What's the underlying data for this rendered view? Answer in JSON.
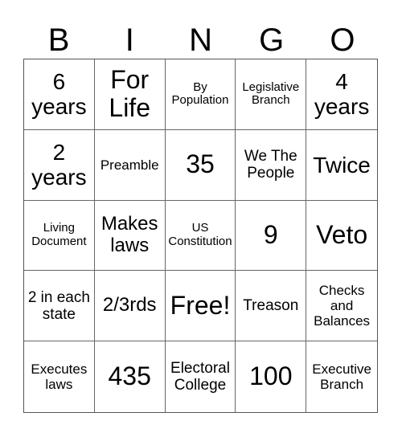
{
  "header": [
    "B",
    "I",
    "N",
    "G",
    "O"
  ],
  "cells": [
    {
      "text": "6 years",
      "size": "s4"
    },
    {
      "text": "For Life",
      "size": "s5"
    },
    {
      "text": "By Population",
      "size": "s1"
    },
    {
      "text": "Legislative Branch",
      "size": "s1"
    },
    {
      "text": "4 years",
      "size": "s4"
    },
    {
      "text": "2 years",
      "size": "s4"
    },
    {
      "text": "Preamble",
      "size": "s3"
    },
    {
      "text": "35",
      "size": "s5"
    },
    {
      "text": "We The People",
      "size": "s2"
    },
    {
      "text": "Twice",
      "size": "s4"
    },
    {
      "text": "Living Document",
      "size": "s1"
    },
    {
      "text": "Makes laws",
      "size": "s6"
    },
    {
      "text": "US Constitution",
      "size": "s1"
    },
    {
      "text": "9",
      "size": "s5"
    },
    {
      "text": "Veto",
      "size": "s5"
    },
    {
      "text": "2 in each state",
      "size": "s2"
    },
    {
      "text": "2/3rds",
      "size": "s6"
    },
    {
      "text": "Free!",
      "size": "s5"
    },
    {
      "text": "Treason",
      "size": "s2"
    },
    {
      "text": "Checks and Balances",
      "size": "s3"
    },
    {
      "text": "Executes laws",
      "size": "s3"
    },
    {
      "text": "435",
      "size": "s5"
    },
    {
      "text": "Electoral College",
      "size": "s2"
    },
    {
      "text": "100",
      "size": "s5"
    },
    {
      "text": "Executive Branch",
      "size": "s3"
    }
  ]
}
